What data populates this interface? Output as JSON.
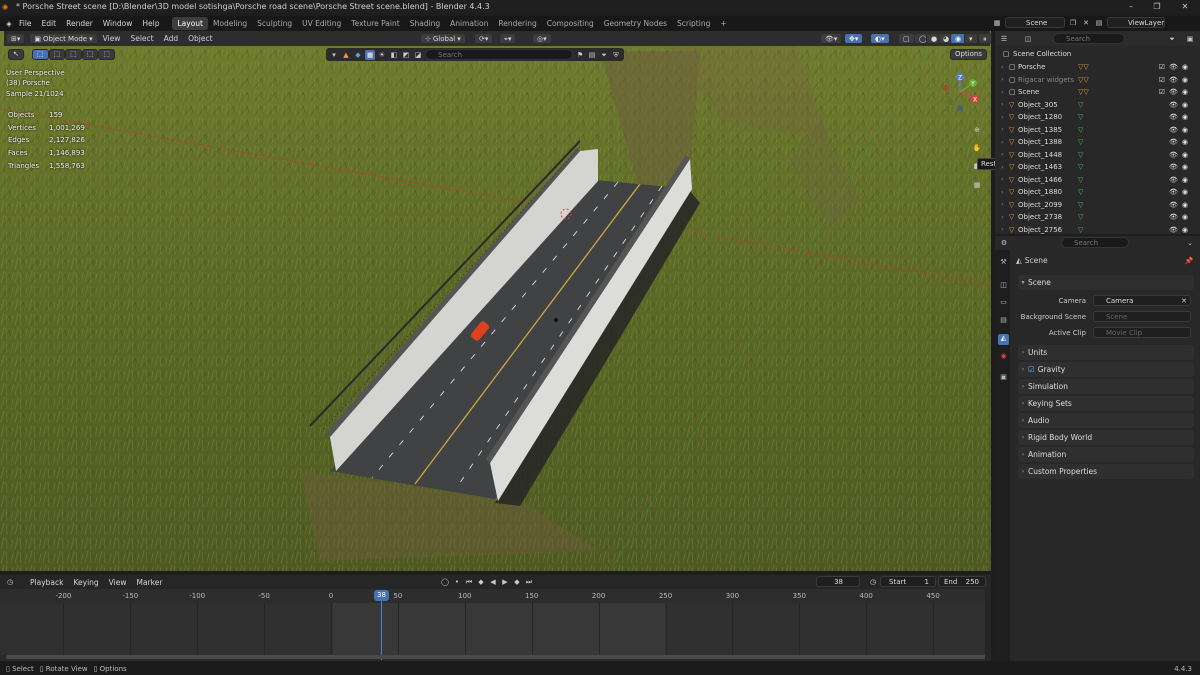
{
  "window": {
    "title": "* Porsche Street scene [D:\\Blender\\3D model sotishga\\Porsche road scene\\Porsche Street scene.blend] - Blender 4.4.3",
    "minimize": "–",
    "maximize": "❐",
    "close": "✕"
  },
  "menu": {
    "items": [
      "File",
      "Edit",
      "Render",
      "Window",
      "Help"
    ],
    "workspaces": [
      "Layout",
      "Modeling",
      "Sculpting",
      "UV Editing",
      "Texture Paint",
      "Shading",
      "Animation",
      "Rendering",
      "Compositing",
      "Geometry Nodes",
      "Scripting"
    ],
    "active_workspace": "Layout",
    "add_workspace": "+",
    "scene_label": "Scene",
    "viewlayer_label": "ViewLayer"
  },
  "viewport_header": {
    "mode": "Object Mode",
    "menus": [
      "View",
      "Select",
      "Add",
      "Object"
    ],
    "transform": "Global",
    "options": "Options",
    "search_placeholder": "Search"
  },
  "viewport_overlay": {
    "lines": [
      "User Perspective",
      "(38) Porsche",
      "Sample 21/1024"
    ],
    "stats": [
      {
        "label": "Objects",
        "value": "159"
      },
      {
        "label": "Vertices",
        "value": "1,001,269"
      },
      {
        "label": "Edges",
        "value": "2,127,826"
      },
      {
        "label": "Faces",
        "value": "1,146,893"
      },
      {
        "label": "Triangles",
        "value": "1,558,763"
      }
    ],
    "tooltip": "Restore Up",
    "gizmo_axes": [
      "Z",
      "Y",
      "X"
    ]
  },
  "outliner": {
    "search_placeholder": "Search",
    "root": "Scene Collection",
    "rows": [
      {
        "name": "Porsche",
        "type": "collection"
      },
      {
        "name": "Rigacar widgets",
        "type": "collection",
        "muted": true
      },
      {
        "name": "Scene",
        "type": "collection"
      },
      {
        "name": "Object_305",
        "type": "object"
      },
      {
        "name": "Object_1280",
        "type": "object"
      },
      {
        "name": "Object_1385",
        "type": "object"
      },
      {
        "name": "Object_1388",
        "type": "object"
      },
      {
        "name": "Object_1448",
        "type": "object"
      },
      {
        "name": "Object_1463",
        "type": "object"
      },
      {
        "name": "Object_1466",
        "type": "object"
      },
      {
        "name": "Object_1880",
        "type": "object"
      },
      {
        "name": "Object_2099",
        "type": "object"
      },
      {
        "name": "Object_2738",
        "type": "object"
      },
      {
        "name": "Object_2756",
        "type": "object"
      }
    ]
  },
  "properties": {
    "search_placeholder": "Search",
    "breadcrumb": "Scene",
    "panel_title": "Scene",
    "fields": [
      {
        "label": "Camera",
        "value": "Camera",
        "dim": false
      },
      {
        "label": "Background Scene",
        "value": "Scene",
        "dim": true
      },
      {
        "label": "Active Clip",
        "value": "Movie Clip",
        "dim": true
      }
    ],
    "panels": [
      "Units",
      "Gravity",
      "Simulation",
      "Keying Sets",
      "Audio",
      "Rigid Body World",
      "Animation",
      "Custom Properties"
    ],
    "gravity_checked": true
  },
  "timeline": {
    "menus": [
      "Playback",
      "Keying",
      "View",
      "Marker"
    ],
    "current_frame": "38",
    "start_label": "Start",
    "start_value": "1",
    "end_label": "End",
    "end_value": "250",
    "ruler_ticks": [
      "-200",
      "-150",
      "-100",
      "-50",
      "0",
      "50",
      "100",
      "150",
      "200",
      "250",
      "300",
      "350",
      "400",
      "450"
    ],
    "playhead_label": "38"
  },
  "statusbar": {
    "items": [
      "Select",
      "Rotate View",
      "Options"
    ],
    "version": "4.4.3"
  }
}
